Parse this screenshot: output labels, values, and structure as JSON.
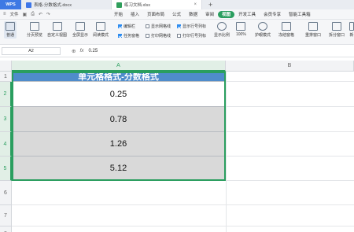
{
  "tabs": {
    "wps": "WPS",
    "doc": "表格-分数格式.docx",
    "sheet": "练习文档.xlsx",
    "new_tab": "+"
  },
  "menubar": {
    "file": "文件",
    "items": [
      "开始",
      "插入",
      "页面布局",
      "公式",
      "数据",
      "审阅",
      "视图",
      "开发工具",
      "会员专享",
      "智能工具箱"
    ],
    "active_index": 6
  },
  "ribbon": {
    "normal": "普通",
    "page_break_preview": "分页预览",
    "custom_view": "自定义视图",
    "fullscreen": "全屏显示",
    "reading_mode": "阅读模式",
    "edit_bar": "编辑栏",
    "task_pane": "任务窗格",
    "show_gridlines": "显示网格线",
    "print_gridlines": "打印网格线",
    "show_row_col_headers": "显示行号列标",
    "print_row_col_headers": "打印行号列标",
    "zoom": "显示比例",
    "zoom_100": "100%",
    "eye_protection": "护眼模式",
    "freeze_panes": "冻结窗格",
    "rearrange_windows": "重排窗口",
    "split_window": "拆分窗口",
    "new_window": "新"
  },
  "formula": {
    "name_box": "A2",
    "value": "0.25"
  },
  "grid": {
    "columns": [
      "A",
      "B"
    ],
    "rows": [
      "1",
      "2",
      "3",
      "4",
      "5",
      "6",
      "7",
      "8"
    ],
    "header_text": "单元格格式-分数格式",
    "values": [
      "0.25",
      "0.78",
      "1.26",
      "5.12"
    ]
  },
  "colors": {
    "accent_green": "#2a9e5f",
    "header_blue": "#4f8ccb",
    "data_gray": "#d9d9d9",
    "wps_blue": "#3e79e4"
  }
}
